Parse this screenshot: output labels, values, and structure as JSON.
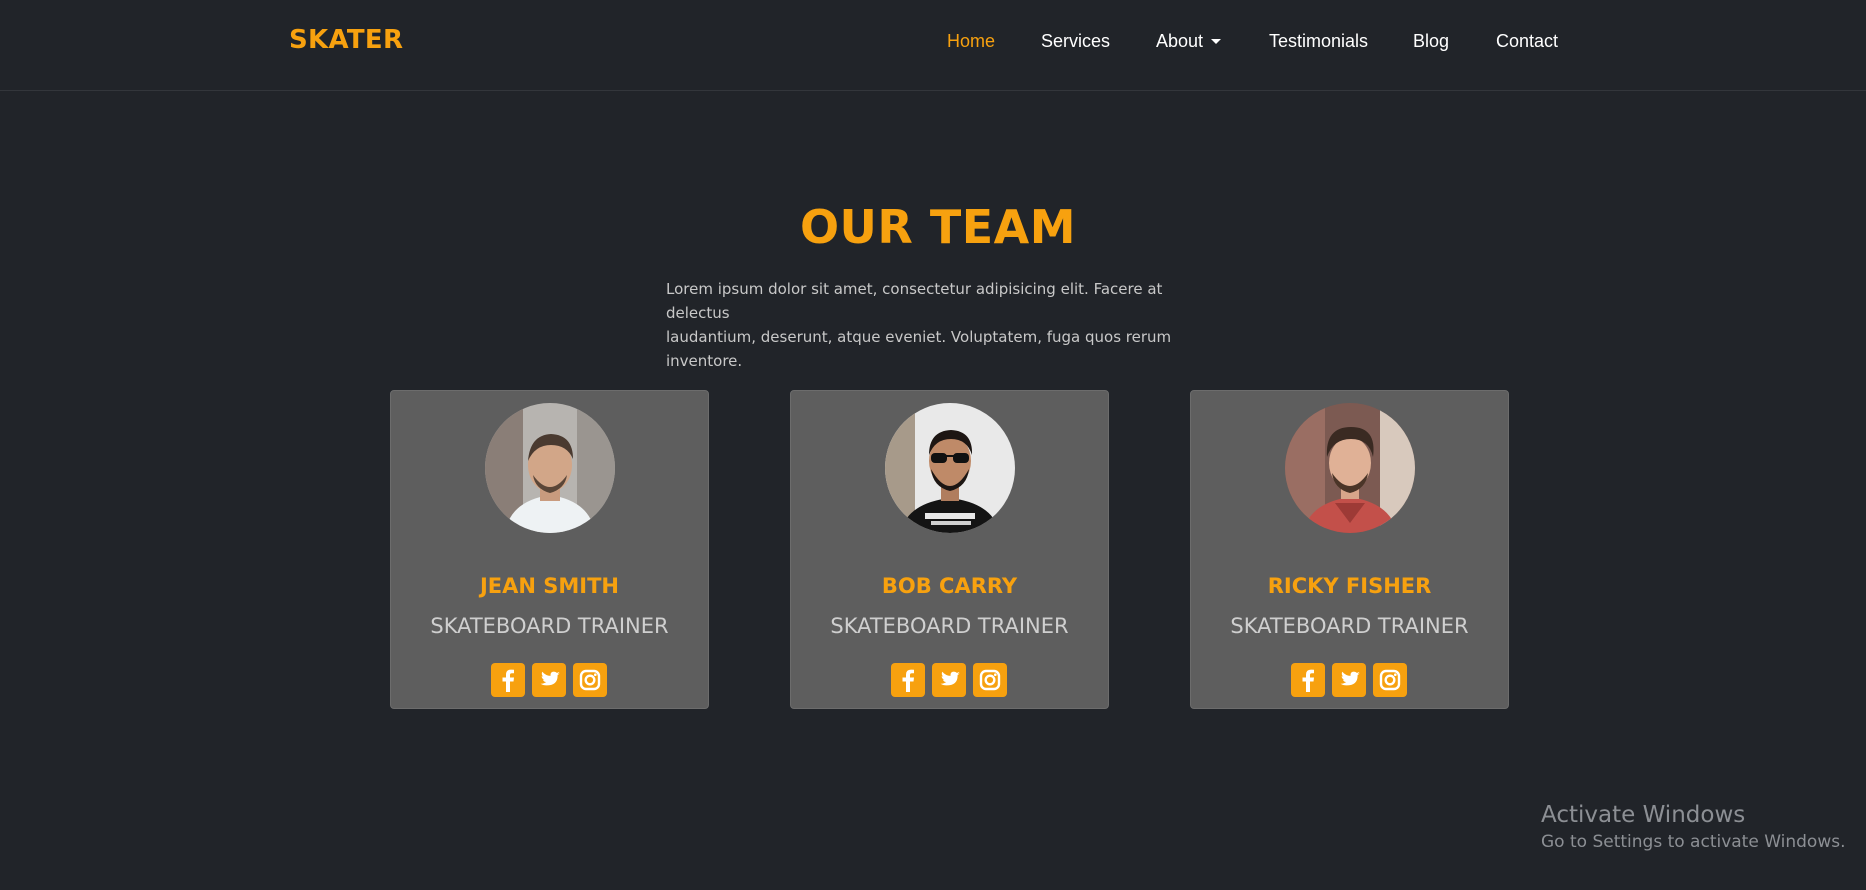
{
  "brand": "SKATER",
  "nav": {
    "items": [
      {
        "label": "Home",
        "active": true
      },
      {
        "label": "Services"
      },
      {
        "label": "About",
        "dropdown": true
      },
      {
        "label": "Testimonials"
      },
      {
        "label": "Blog"
      },
      {
        "label": "Contact"
      }
    ]
  },
  "team": {
    "title": "OUR TEAM",
    "description_line1": "Lorem ipsum dolor sit amet, consectetur adipisicing elit. Facere at delectus",
    "description_line2": "laudantium, deserunt, atque eveniet. Voluptatem, fuga quos rerum inventore.",
    "members": [
      {
        "name": "JEAN SMITH",
        "role": "SKATEBOARD TRAINER",
        "socials": [
          "facebook-icon",
          "twitter-icon",
          "instagram-icon"
        ]
      },
      {
        "name": "BOB CARRY",
        "role": "SKATEBOARD TRAINER",
        "socials": [
          "facebook-icon",
          "twitter-icon",
          "instagram-icon"
        ]
      },
      {
        "name": "RICKY FISHER",
        "role": "SKATEBOARD TRAINER",
        "socials": [
          "facebook-icon",
          "twitter-icon",
          "instagram-icon"
        ]
      }
    ]
  },
  "watermark": {
    "title": "Activate Windows",
    "subtitle": "Go to Settings to activate Windows."
  },
  "colors": {
    "background": "#212429",
    "accent": "#f7a10f",
    "card": "#5e5e5e"
  }
}
